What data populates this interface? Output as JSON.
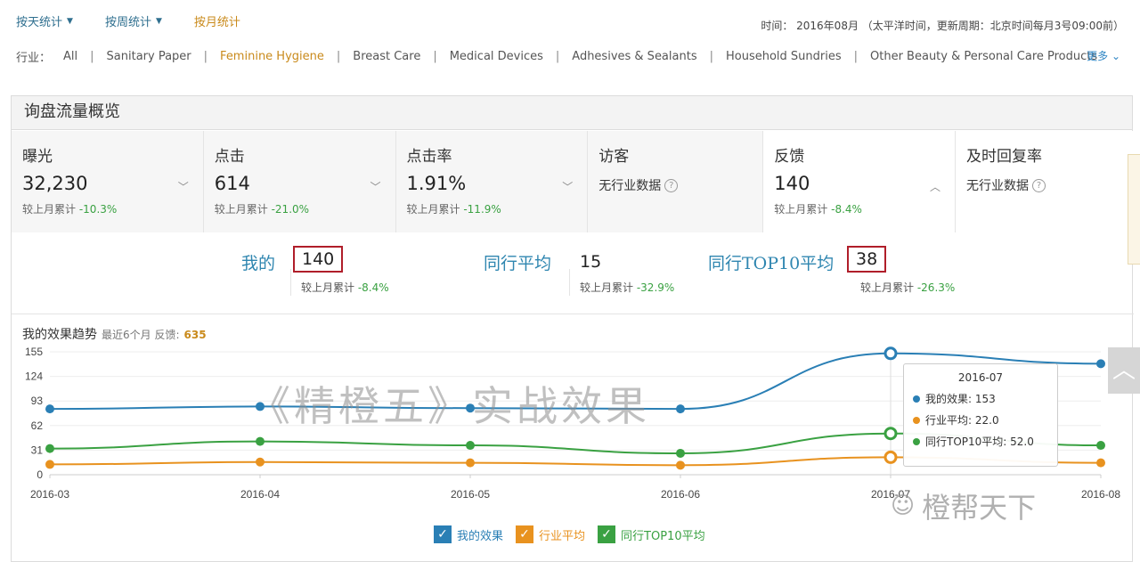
{
  "top_tabs": [
    {
      "label": "按天统计",
      "caret": "▼"
    },
    {
      "label": "按周统计",
      "caret": "▼"
    },
    {
      "label": "按月统计"
    }
  ],
  "time_info": "时间： 2016年08月 （太平洋时间，更新周期：北京时间每月3号09:00前）",
  "industry": {
    "label": "行业：",
    "items": [
      "All",
      "Sanitary Paper",
      "Feminine Hygiene",
      "Breast Care",
      "Medical Devices",
      "Adhesives & Sealants",
      "Household Sundries",
      "Other Beauty & Personal Care Products"
    ],
    "active": "Feminine Hygiene",
    "more": "更多 ⌄"
  },
  "panel_title": "询盘流量概览",
  "metrics": [
    {
      "name": "曝光",
      "value": "32,230",
      "compare_label": "较上月累计",
      "change": "-10.3%"
    },
    {
      "name": "点击",
      "value": "614",
      "compare_label": "较上月累计",
      "change": "-21.0%"
    },
    {
      "name": "点击率",
      "value": "1.91%",
      "compare_label": "较上月累计",
      "change": "-11.9%"
    },
    {
      "name": "访客",
      "nodata": "无行业数据"
    },
    {
      "name": "反馈",
      "value": "140",
      "compare_label": "较上月累计",
      "change": "-8.4%"
    },
    {
      "name": "及时回复率",
      "nodata": "无行业数据"
    }
  ],
  "compare": {
    "mine": {
      "label": "我的",
      "value": "140",
      "compare_label": "较上月累计",
      "change": "-8.4%"
    },
    "avg": {
      "label": "同行平均",
      "value": "15",
      "compare_label": "较上月累计",
      "change": "-32.9%"
    },
    "top10": {
      "label": "同行TOP10平均",
      "value": "38",
      "compare_label": "较上月累计",
      "change": "-26.3%"
    }
  },
  "trend": {
    "title": "我的效果趋势",
    "subtitle": "最近6个月 反馈:",
    "feedback_total": "635"
  },
  "chart_data": {
    "type": "line",
    "x": [
      "2016-03",
      "2016-04",
      "2016-05",
      "2016-06",
      "2016-07",
      "2016-08"
    ],
    "y_ticks": [
      0,
      31,
      62,
      93,
      124,
      155
    ],
    "ylim": [
      0,
      155
    ],
    "series": [
      {
        "name": "我的效果",
        "color": "#2a7fb5",
        "values": [
          83,
          86,
          84,
          83,
          153,
          140
        ]
      },
      {
        "name": "行业平均",
        "color": "#e8921f",
        "values": [
          13,
          16,
          15,
          12,
          22,
          15
        ]
      },
      {
        "name": "同行TOP10平均",
        "color": "#3aa142",
        "values": [
          33,
          42,
          37,
          27,
          52,
          37
        ]
      }
    ]
  },
  "tooltip": {
    "title": "2016-07",
    "rows": [
      "我的效果: 153",
      "行业平均: 22.0",
      "同行TOP10平均: 52.0"
    ]
  },
  "watermark": "《精橙五》实战效果",
  "wechat_mark": "橙帮天下",
  "colors": {
    "blue": "#2a7fb5",
    "orange": "#e8921f",
    "green": "#3aa142",
    "accent": "#c98a1b",
    "highlight_box": "#b01e2a"
  }
}
